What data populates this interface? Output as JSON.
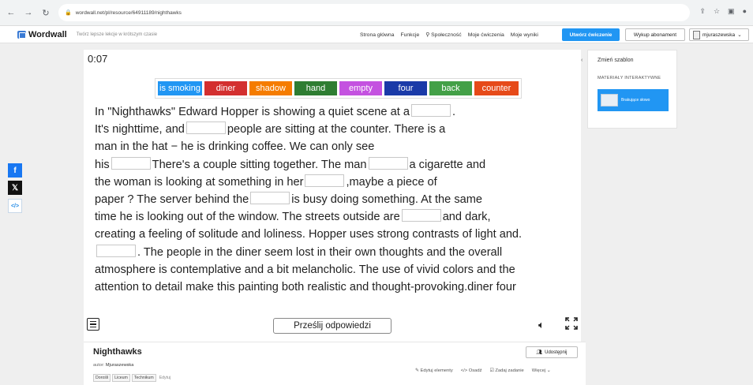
{
  "browser": {
    "url": "wordwall.net/pl/resource/64911189/nighthawks"
  },
  "header": {
    "logo": "Wordwall",
    "tagline": "Twórz lepsze lekcje w krótszym czasie",
    "nav": [
      "Strona główna",
      "Funkcje",
      "Społeczność",
      "Moje ćwiczenia",
      "Moje wyniki"
    ],
    "create": "Utwórz ćwiczenie",
    "subscribe": "Wykup abonament",
    "user": "mjuraszewska"
  },
  "activity": {
    "timer": "0:07",
    "words": [
      {
        "text": "is smoking",
        "color": "#2196f3"
      },
      {
        "text": "diner",
        "color": "#d32f2f"
      },
      {
        "text": "shadow",
        "color": "#f57c00"
      },
      {
        "text": "hand",
        "color": "#2e7d32"
      },
      {
        "text": "empty",
        "color": "#c452e0"
      },
      {
        "text": "four",
        "color": "#1a3aa8"
      },
      {
        "text": "back",
        "color": "#43a047"
      },
      {
        "text": "counter",
        "color": "#e64a19"
      }
    ],
    "lines": [
      [
        "In \"Nighthawks\" Edward Hopper is showing a quiet scene at a",
        "."
      ],
      [
        "It's nighttime, and",
        "people are sitting at the counter. There is a"
      ],
      [
        "man in the hat − he is drinking coffee. We can only see"
      ],
      [
        "his",
        "There's a couple sitting together. The man",
        "a cigarette and"
      ],
      [
        "the woman is looking at something in her",
        ",maybe a piece of"
      ],
      [
        "paper ? The server behind the",
        "is busy doing something. At the same"
      ],
      [
        "time he is looking out of the window. The streets outside are",
        "and dark,"
      ],
      [
        "creating a feeling of solitude and loliness. Hopper uses strong contrasts of light and."
      ],
      [
        "",
        ". The people in the diner seem lost in their own thoughts and the overall"
      ],
      [
        "atmosphere is contemplative and a bit melancholic. The use of vivid colors and the"
      ],
      [
        "attention to detail make this painting both realistic and thought-provoking.diner four"
      ]
    ],
    "submit": "Prześlij odpowiedzi"
  },
  "templates": {
    "change": "Zmień szablon",
    "section": "MATERIAŁY INTERAKTYWNE",
    "card": "Brakujące słowo"
  },
  "info": {
    "title": "Nighthawks",
    "author_label": "autor:",
    "author": "Mjuraszewska",
    "tags": [
      "Dorośli",
      "Liceum",
      "Technikum"
    ],
    "edit_tags": "Edytuj",
    "share": "Udostępnij",
    "actions": [
      "Edytuj elementy",
      "Osadź",
      "Zadaj zadanie",
      "Więcej"
    ]
  },
  "colors": {
    "accent": "#2196f3"
  }
}
